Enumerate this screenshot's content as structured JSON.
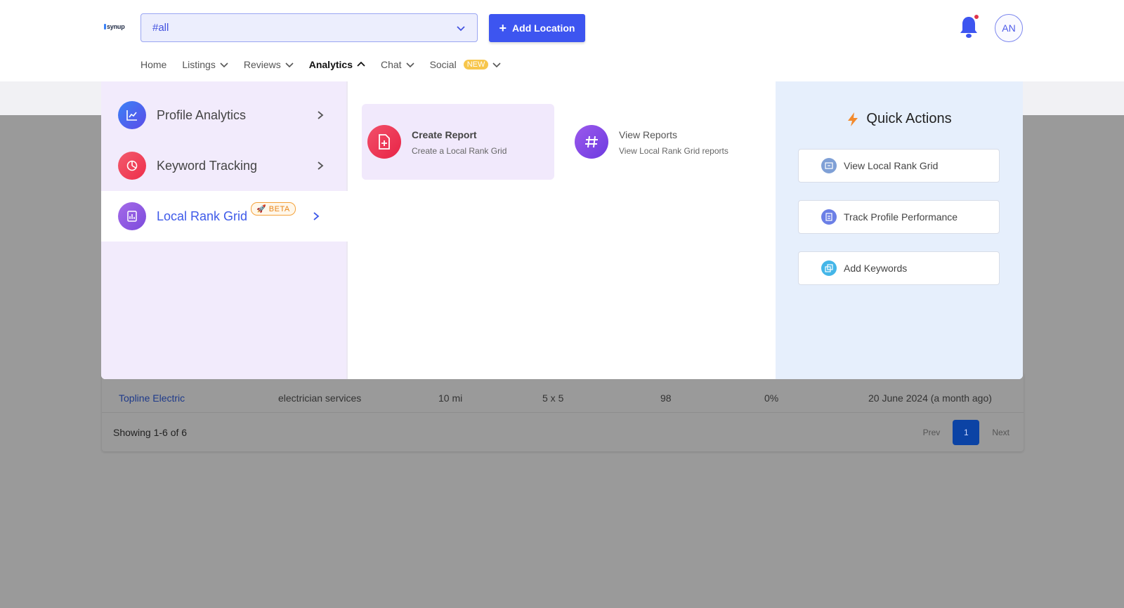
{
  "header": {
    "logo_text": "synup",
    "location_select_value": "#all",
    "add_location_label": "Add Location",
    "avatar_initials": "AN"
  },
  "nav": {
    "items": [
      {
        "label": "Home"
      },
      {
        "label": "Listings"
      },
      {
        "label": "Reviews"
      },
      {
        "label": "Analytics"
      },
      {
        "label": "Chat"
      },
      {
        "label": "Social"
      }
    ],
    "new_badge": "NEW"
  },
  "analytics_menu": {
    "left_items": [
      {
        "label": "Profile Analytics"
      },
      {
        "label": "Keyword Tracking"
      },
      {
        "label": "Local Rank Grid"
      }
    ],
    "beta_badge": "BETA",
    "cards": [
      {
        "title": "Create Report",
        "subtitle": "Create a Local Rank Grid"
      },
      {
        "title": "View Reports",
        "subtitle": "View Local Rank Grid reports"
      }
    ],
    "quick_actions": {
      "title": "Quick Actions",
      "buttons": [
        {
          "label": "View Local Rank Grid"
        },
        {
          "label": "Track Profile Performance"
        },
        {
          "label": "Add Keywords"
        }
      ]
    }
  },
  "table": {
    "row": {
      "name": "Topline Electric",
      "keyword": "electrician services",
      "radius": "10 mi",
      "grid": "5 x 5",
      "score": "98",
      "change": "0%",
      "date": "20 June 2024 (a month ago)"
    },
    "showing": "Showing 1-6 of 6",
    "pager": {
      "prev": "Prev",
      "page": "1",
      "next": "Next"
    }
  },
  "colors": {
    "accent": "#3d55f0",
    "left_panel_bg": "#f2ebfc",
    "quick_actions_bg": "#e6effc",
    "overlay": "#9a9a9a"
  }
}
